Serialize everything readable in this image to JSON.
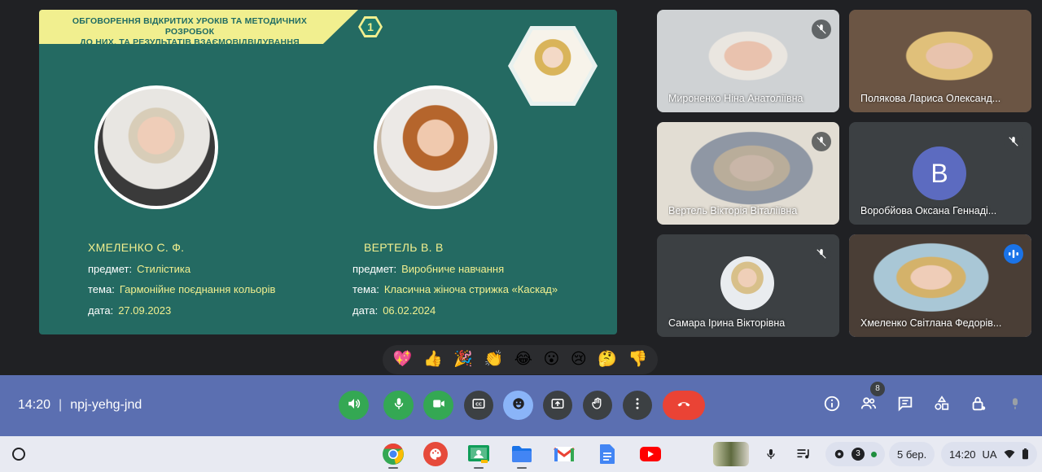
{
  "slide": {
    "banner_line1": "ОБГОВОРЕННЯ ВІДКРИТИХ УРОКІВ ТА МЕТОДИЧНИХ РОЗРОБОК",
    "banner_line2": "ДО НИХ, ТА РЕЗУЛЬТАТІВ ВЗАЄМОВІДВІДУВАННЯ",
    "number": "1",
    "teachers": [
      {
        "name": "ХМЕЛЕНКО С. Ф.",
        "subject_label": "предмет:",
        "subject": "Стилістика",
        "topic_label": "тема:",
        "topic": "Гармонійне поєднання кольорів",
        "date_label": "дата:",
        "date": "27.09.2023"
      },
      {
        "name": "ВЕРТЕЛЬ В. В",
        "subject_label": "предмет:",
        "subject": "Виробниче навчання",
        "topic_label": "тема:",
        "topic": "Класична жіноча стрижка «Каскад»",
        "date_label": "дата:",
        "date": "06.02.2024"
      }
    ],
    "accent_color": "#f1ef8f",
    "background_color": "#246a62"
  },
  "participants": [
    {
      "name": "Мироненко Ніна Анатоліївна",
      "muted": true
    },
    {
      "name": "Полякова Лариса Олександ...",
      "muted": false
    },
    {
      "name": "Вертель Вікторія Віталіївна",
      "muted": true
    },
    {
      "name": "Воробйова Оксана Геннаді...",
      "muted": true,
      "avatar_letter": "В"
    },
    {
      "name": "Самара Ірина Вікторівна",
      "muted": true
    },
    {
      "name": "Хмеленко Світлана Федорів...",
      "muted": false,
      "speaking": true
    }
  ],
  "reactions": [
    "💖",
    "👍",
    "🎉",
    "👏",
    "😂",
    "😮",
    "😢",
    "🤔",
    "👎"
  ],
  "meeting": {
    "time": "14:20",
    "separator": "|",
    "code": "npj-yehg-jnd",
    "participant_count": "8"
  },
  "icons": {
    "audio": "speaker-icon",
    "mic": "mic-icon",
    "camera": "camera-icon",
    "captions": "captions-icon",
    "emoji": "emoji-icon",
    "present": "present-icon",
    "raise_hand": "hand-icon",
    "more": "more-vert-icon",
    "leave": "hang-up-icon",
    "info": "info-icon",
    "people": "people-icon",
    "chat": "chat-icon",
    "activities": "shapes-icon",
    "host_controls": "lock-person-icon",
    "mic_gray": "mic-off-icon"
  },
  "shelf": {
    "apps": [
      "chrome",
      "paint",
      "classroom",
      "files",
      "gmail",
      "docs",
      "youtube"
    ],
    "notification_count": "3",
    "date": "5 бер.",
    "time": "14:20",
    "locale": "UA"
  }
}
